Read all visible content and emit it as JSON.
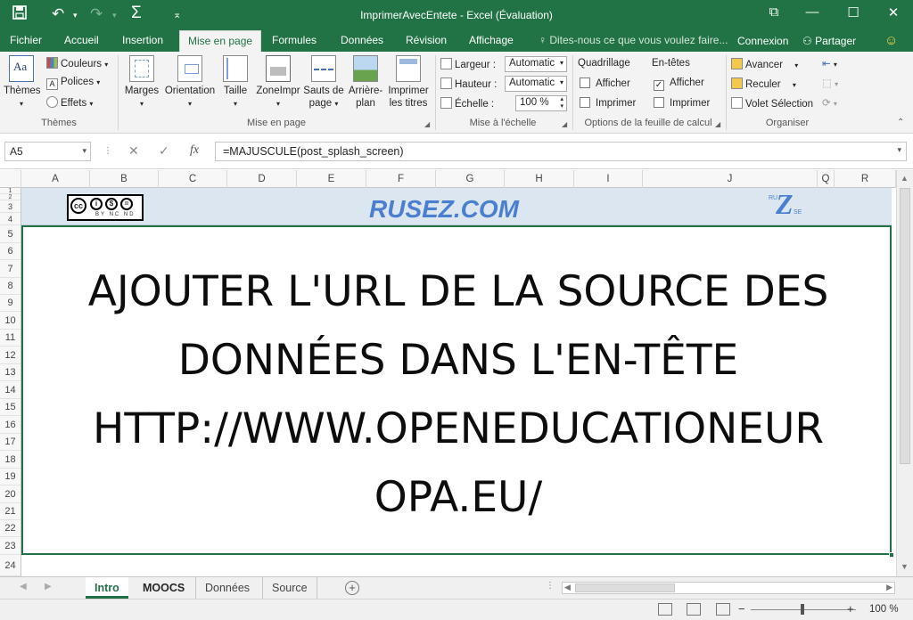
{
  "window": {
    "title": "ImprimerAvecEntete - Excel (Évaluation)",
    "quick_access": {
      "save": "💾",
      "undo": "↶",
      "redo": "↷",
      "sum": "Σ",
      "customize": "⌅"
    },
    "controls": {
      "ribbon_display": "⧉",
      "minimize": "—",
      "maximize": "☐",
      "close": "✕"
    }
  },
  "tabs": {
    "items": [
      "Fichier",
      "Accueil",
      "Insertion",
      "Mise en page",
      "Formules",
      "Données",
      "Révision",
      "Affichage"
    ],
    "active": "Mise en page",
    "tell_me": "Dites-nous ce que vous voulez faire...",
    "connexion": "Connexion",
    "share": "Partager"
  },
  "ribbon": {
    "themes": {
      "themes_btn": "Thèmes",
      "couleurs": "Couleurs",
      "polices": "Polices",
      "effets": "Effets",
      "label": "Thèmes"
    },
    "mise_en_page": {
      "marges": "Marges",
      "orientation": "Orientation",
      "taille": "Taille",
      "zone": "ZoneImpr",
      "sauts_1": "Sauts de",
      "sauts_2": "page",
      "arriere_1": "Arrière-",
      "arriere_2": "plan",
      "imprimer_1": "Imprimer",
      "imprimer_2": "les titres",
      "label": "Mise en page"
    },
    "echelle": {
      "largeur_label": "Largeur :",
      "largeur_value": "Automatic",
      "hauteur_label": "Hauteur :",
      "hauteur_value": "Automatic",
      "echelle_label": "Échelle :",
      "echelle_value": "100 %",
      "label": "Mise à l'échelle"
    },
    "options": {
      "quadrillage": "Quadrillage",
      "entetes": "En-têtes",
      "afficher": "Afficher",
      "imprimer": "Imprimer",
      "grid_show_checked": false,
      "grid_print_checked": false,
      "head_show_checked": true,
      "head_print_checked": false,
      "label": "Options de la feuille de calcul"
    },
    "organiser": {
      "avancer": "Avancer",
      "reculer": "Reculer",
      "volet": "Volet Sélection",
      "label": "Organiser"
    }
  },
  "formula_bar": {
    "name_box": "A5",
    "fx": "fx",
    "cancel": "✕",
    "enter": "✓",
    "formula": "=MAJUSCULE(post_splash_screen)"
  },
  "grid": {
    "columns": [
      "A",
      "B",
      "C",
      "D",
      "E",
      "F",
      "G",
      "H",
      "I",
      "J",
      "Q",
      "R"
    ],
    "rows": [
      "1",
      "2",
      "3",
      "4",
      "5",
      "6",
      "7",
      "8",
      "9",
      "10",
      "11",
      "12",
      "13",
      "14",
      "15",
      "16",
      "17",
      "18",
      "19",
      "20",
      "21",
      "22",
      "23",
      "24"
    ],
    "banner_site": "RUSEZ.COM",
    "cc_license": "BY  NC  ND",
    "logo_letters": {
      "top": "RU",
      "mid": "Z",
      "bottom": "SE"
    },
    "cell_text": "AJOUTER L'URL DE LA SOURCE DES DONNÉES DANS L'EN-TÊTE HTTP://WWW.OPENEDUCATIONEUR OPA.EU/",
    "cell_lines": [
      "AJOUTER L'URL DE LA SOURCE DES",
      "DONNÉES DANS L'EN-TÊTE",
      "HTTP://WWW.OPENEDUCATIONEUR",
      "OPA.EU/"
    ]
  },
  "sheets": {
    "items": [
      "Intro",
      "MOOCS",
      "Données",
      "Source"
    ],
    "active": "Intro"
  },
  "status": {
    "zoom": "100 %",
    "zoom_level": 1.0
  },
  "colors": {
    "accent": "#217346",
    "banner": "#dce6f1",
    "site_text": "#4a7fd0"
  }
}
